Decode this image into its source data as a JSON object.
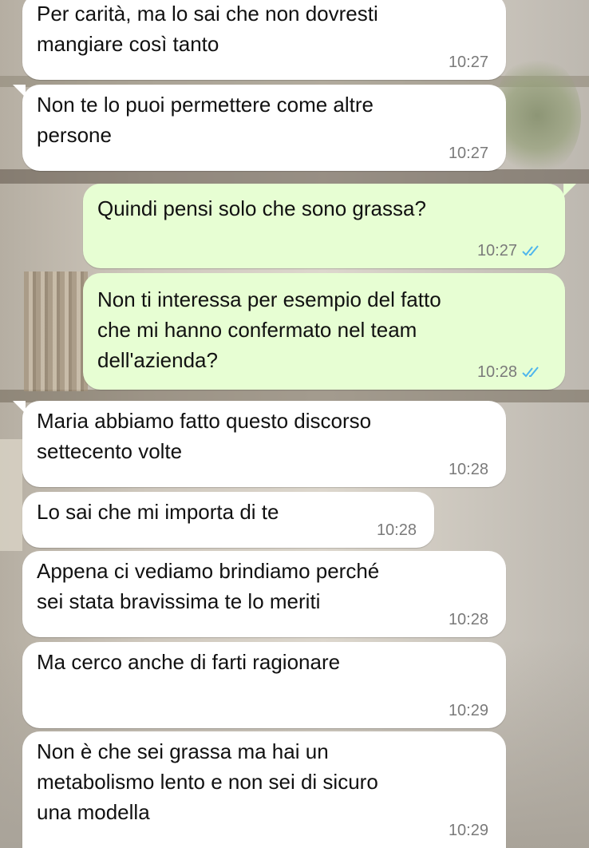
{
  "colors": {
    "incoming_bubble": "#ffffff",
    "outgoing_bubble": "#e7fed3",
    "read_ticks": "#4fb6ec",
    "timestamp": "#7a7a7a"
  },
  "messages": [
    {
      "direction": "incoming",
      "text": "Per carità, ma lo sai che non dovresti\nmangiare così tanto",
      "time": "10:27"
    },
    {
      "direction": "incoming",
      "text": "Non te lo puoi permettere come altre\npersone",
      "time": "10:27"
    },
    {
      "direction": "outgoing",
      "text": "Quindi pensi solo che sono grassa?",
      "time": "10:27",
      "status_icon": "double-check-read-icon"
    },
    {
      "direction": "outgoing",
      "text": "Non ti interessa per esempio del fatto\nche mi hanno confermato nel team\ndell'azienda?",
      "time": "10:28",
      "status_icon": "double-check-read-icon"
    },
    {
      "direction": "incoming",
      "text": "Maria abbiamo fatto questo discorso\nsettecento volte",
      "time": "10:28"
    },
    {
      "direction": "incoming",
      "text": "Lo sai che mi importa di te",
      "time": "10:28"
    },
    {
      "direction": "incoming",
      "text": "Appena ci vediamo brindiamo perché\nsei stata bravissima te lo meriti",
      "time": "10:28"
    },
    {
      "direction": "incoming",
      "text": "Ma cerco anche di farti ragionare",
      "time": "10:29"
    },
    {
      "direction": "incoming",
      "text": "Non è che sei grassa ma hai un\nmetabolismo lento e non sei di sicuro\nuna modella",
      "time": "10:29"
    }
  ]
}
